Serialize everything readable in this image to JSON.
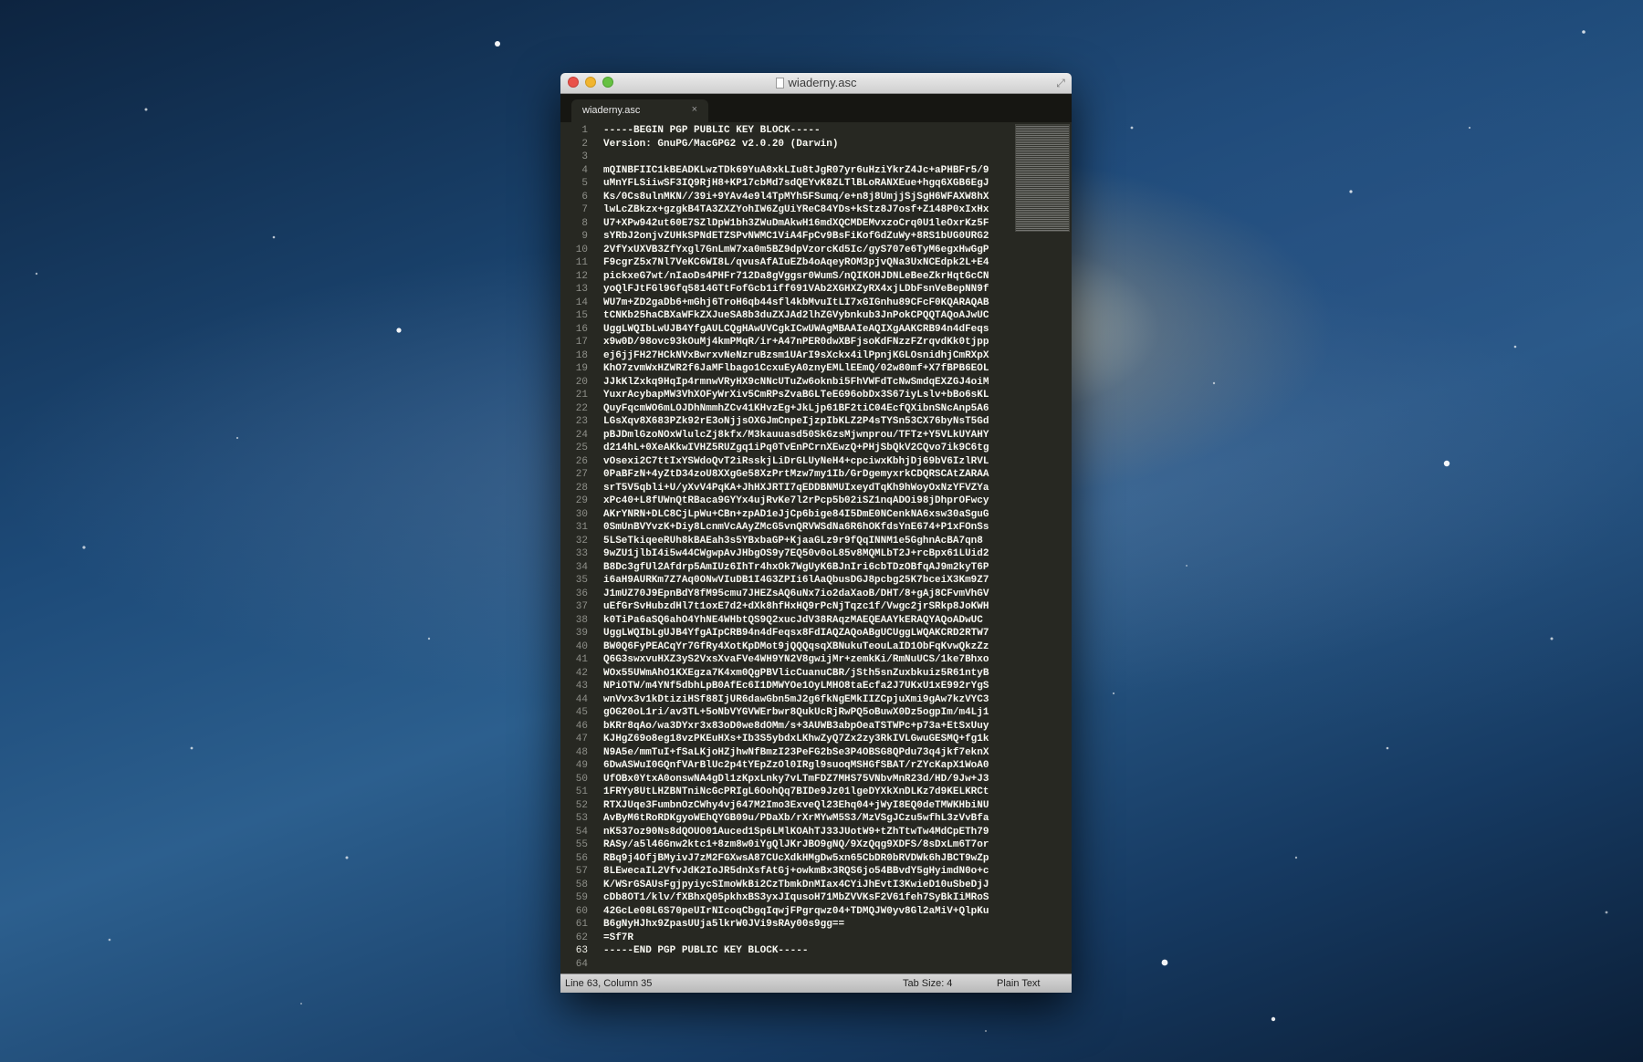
{
  "window": {
    "title": "wiaderny.asc"
  },
  "tab": {
    "label": "wiaderny.asc",
    "close": "×"
  },
  "editor": {
    "current_line": 63,
    "lines": [
      "-----BEGIN PGP PUBLIC KEY BLOCK-----",
      "Version: GnuPG/MacGPG2 v2.0.20 (Darwin)",
      "",
      "mQINBFIIC1kBEADKLwzTDk69YuA8xkLIu8tJgR07yr6uHziYkrZ4Jc+aPHBFr5/9",
      "uMnYFLSiiwSF3IQ9RjH8+KP17cbMd7sdQEYvK8ZLTlBLoRANXEue+hgq6XGB6EgJ",
      "Ks/0Cs8ulnMKN//39i+9YAv4e9l4TpMYh5FSumq/e+n8j8UmjjSjSgH6WFAXW8hX",
      "lwLcZBkzx+gzgkB4TA3ZXZYohIW6ZgUiYReC84YDs+kStz8J7osf+Z148P0xIxHx",
      "U7+XPw942ut60E7SZlDpW1bh3ZWuDmAkwH16mdXQCMDEMvxzoCrq0U1leOxrKz5F",
      "sYRbJ2onjvZUHkSPNdETZSPvNWMC1ViA4FpCv9BsFiKofGdZuWy+8RS1bUG0URG2",
      "2VfYxUXVB3ZfYxgl7GnLmW7xa0m5BZ9dpVzorcKd5Ic/gyS707e6TyM6egxHwGgP",
      "F9cgrZ5x7Nl7VeKC6WI8L/qvusAfAIuEZb4oAqeyROM3pjvQNa3UxNCEdpk2L+E4",
      "pickxeG7wt/nIaoDs4PHFr712Da8gVggsr0WumS/nQIKOHJDNLeBeeZkrHqtGcCN",
      "yoQlFJtFGl9Gfq5814GTtFofGcb1iff691VAb2XGHXZyRX4xjLDbFsnVeBepNN9f",
      "WU7m+ZD2gaDb6+mGhj6TroH6qb44sfl4kbMvuItLI7xGIGnhu89CFcF0KQARAQAB",
      "tCNKb25haCBXaWFkZXJueSA8b3duZXJAd2lhZGVybnkub3JnPokCPQQTAQoAJwUC",
      "UggLWQIbLwUJB4YfgAULCQgHAwUVCgkICwUWAgMBAAIeAQIXgAAKCRB94n4dFeqs",
      "x9w0D/98ovc93kOuMj4kmPMqR/ir+A47nPER0dwXBFjsoKdFNzzFZrqvdKk0tjpp",
      "ej6jjFH27HCkNVxBwrxvNeNzruBzsm1UArI9sXckx4ilPpnjKGLOsnidhjCmRXpX",
      "KhO7zvmWxHZWR2f6JaMFlbago1CcxuEyA0znyEMLlEEmQ/02w80mf+X7fBPB6EOL",
      "JJkKlZxkq9HqIp4rmnwVRyHX9cNNcUTuZw6oknbi5FhVWFdTcNwSmdqEXZGJ4oiM",
      "YuxrAcybapMW3VhXOFyWrXiv5CmRPsZvaBGLTeEG96obDx3S67iyLslv+bBo6sKL",
      "QuyFqcmWO6mLOJDhNmmhZCv41KHvzEg+JkLjp61BF2tiC04EcfQXibnSNcAnp5A6",
      "LGsXqv8X683PZk92rE3oNjjsOXGJmCnpeIjzpIbKLZ2P4sTYSn53CX76byNsT5Gd",
      "pBJDmlGzoNOxWlulcZj8kfx/M3kauuasd50SkGzsMjwnprou/TFTz+Y5VLkUYAHY",
      "d214hL+0XeAKkwIVHZ5RUZgq1iPq0TvEnPCrnXEwzQ+PHjSbQkV2CQvo7ik9C6tg",
      "vOsexi2C7ttIxYSWdoQvT2iRsskjLiDrGLUyNeH4+cpciwxKbhjDj69bV6IzlRVL",
      "0PaBFzN+4yZtD34zoU8XXgGe58XzPrtMzw7my1Ib/GrDgemyxrkCDQRSCAtZARAA",
      "srT5V5qbli+U/yXvV4PqKA+JhHXJRTI7qEDDBNMUIxeydTqKh9hWoyOxNzYFVZYa",
      "xPc40+L8fUWnQtRBaca9GYYx4ujRvKe7l2rPcp5b02iSZ1nqADOi98jDhprOFwcy",
      "AKrYNRN+DLC8CjLpWu+CBn+zpAD1eJjCp6bige84I5DmE0NCenkNA6xsw30aSguG",
      "0SmUnBVYvzK+Diy8LcnmVcAAyZMcG5vnQRVWSdNa6R6hOKfdsYnE674+P1xFOnSs",
      "5LSeTkiqeeRUh8kBAEah3s5YBxbaGP+KjaaGLz9r9fQqINNM1e5GghnAcBA7qn8",
      "9wZU1jlbI4i5w44CWgwpAvJHbgOS9y7EQ50v0oL85v8MQMLbT2J+rcBpx61LUid2",
      "B8Dc3gfUl2Afdrp5AmIUz6IhTr4hxOk7WgUyK6BJnIri6cbTDzOBfqAJ9m2kyT6P",
      "i6aH9AURKm7Z7Aq0ONwVIuDB1I4G3ZPIi6lAaQbusDGJ8pcbg25K7bceiX3Km9Z7",
      "J1mUZ70J9EpnBdY8fM95cmu7JHEZsAQ6uNx7io2daXaoB/DHT/8+gAj8CFvmVhGV",
      "uEfGrSvHubzdHl7t1oxE7d2+dXk8hfHxHQ9rPcNjTqzc1f/Vwgc2jrSRkp8JoKWH",
      "k0TiPa6aSQ6ahO4YhNE4WHbtQS9Q2xucJdV38RAqzMAEQEAAYkERAQYAQoADwUC",
      "UggLWQIbLgUJB4YfgAIpCRB94n4dFeqsx8FdIAQZAQoABgUCUggLWQAKCRD2RTW7",
      "BW0Q6FyPEACqYr7GfRy4XotKpDMot9jQQQqsqXBNukuTeouLaID1ObFqKvwQkzZz",
      "Q6G3swxvuHXZ3yS2VxsXvaFVe4WH9YN2V8gwijMr+zemkKi/RmNuUCS/1ke7Bhxo",
      "WOx55UWmAhO1KXEgza7K4xm0QgPBVlicCuanuCBR/jSth5snZuxbkuiz5R61ntyB",
      "NPiOTW/m4YNf5dbhLpB0AfEc6I1DMWYOe1OyLMHO8taEcfa2J7UKxU1xE992rYgS",
      "wnVvx3v1kDtiziHSf88IjUR6dawGbn5mJ2g6fkNgEMkIIZCpjuXmi9gAw7kzVYC3",
      "gOG20oL1ri/av3TL+5oNbVYGVWErbwr8QukUcRjRwPQ5oBuwX0Dz5ogpIm/m4Lj1",
      "bKRr8qAo/wa3DYxr3x83oD0we8dOMm/s+3AUWB3abpOeaTSTWPc+p73a+EtSxUuy",
      "KJHgZ69o8eg18vzPKEuHXs+Ib3S5ybdxLKhwZyQ7Zx2zy3RkIVLGwuGESMQ+fg1k",
      "N9A5e/mmTuI+fSaLKjoHZjhwNfBmzI23PeFG2bSe3P4OBSG8QPdu73q4jkf7eknX",
      "6DwASWuI0GQnfVArBlUc2p4tYEpZzOl0IRgl9suoqMSHGfSBAT/rZYcKapX1WoA0",
      "UfOBx0YtxA0onswNA4gDl1zKpxLnky7vLTmFDZ7MHS75VNbvMnR23d/HD/9Jw+J3",
      "1FRYy8UtLHZBNTniNcGcPRIgL6OohQq7BIDe9Jz01lgeDYXkXnDLKz7d9KELKRCt",
      "RTXJUqe3FumbnOzCWhy4vj647M2Imo3ExveQl23Ehq04+jWyI8EQ0deTMWKHbiNU",
      "AvByM6tRoRDKgyoWEhQYGB09u/PDaXb/rXrMYwM5S3/MzVSgJCzu5wfhL3zVvBfa",
      "nK537oz90Ns8dQOUO01Auced1Sp6LMlKOAhTJ33JUotW9+tZhTtwTw4MdCpETh79",
      "RASy/a5l46Gnw2ktc1+8zm8w0iYgQlJKrJBO9gNQ/9XzQqg9XDFS/8sDxLm6T7or",
      "RBq9j4OfjBMyivJ7zM2FGXwsA87CUcXdkHMgDw5xn65CbDR0bRVDWk6hJBCT9wZp",
      "8LEwecaIL2VfvJdK2IoJR5dnXsfAtGj+owkmBx3RQS6jo54BBvdY5gHyimdN0o+c",
      "K/WSrGSAUsFgjpyiycSImoWkBi2CzTbmkDnMIax4CYiJhEvtI3KwieD10uSbeDjJ",
      "cDb8OT1/klv/fXBhxQ05pkhxBS3yxJIqusoH71MbZVVKsF2V61feh7SyBkIiMRoS",
      "42GcLe08L6S70peUIrNIcoqCbgqIqwjFPgrqwz04+TDMQJW0yv8Gl2aMiV+QlpKu",
      "B6gNyHJhx9ZpasUUja5lkrW0JVi9sRAy00s9gg==",
      "=Sf7R",
      "-----END PGP PUBLIC KEY BLOCK-----",
      ""
    ]
  },
  "statusbar": {
    "position": "Line 63, Column 35",
    "tab_size": "Tab Size: 4",
    "syntax": "Plain Text"
  },
  "icons": {
    "close_window": "close-icon",
    "minimize_window": "minimize-icon",
    "zoom_window": "zoom-icon",
    "document": "document-icon",
    "fullscreen": "fullscreen-icon",
    "tab_close": "close-icon"
  },
  "colors": {
    "editor_background": "#272822",
    "editor_text": "#f8f8f2",
    "gutter_text": "#8f908a"
  }
}
